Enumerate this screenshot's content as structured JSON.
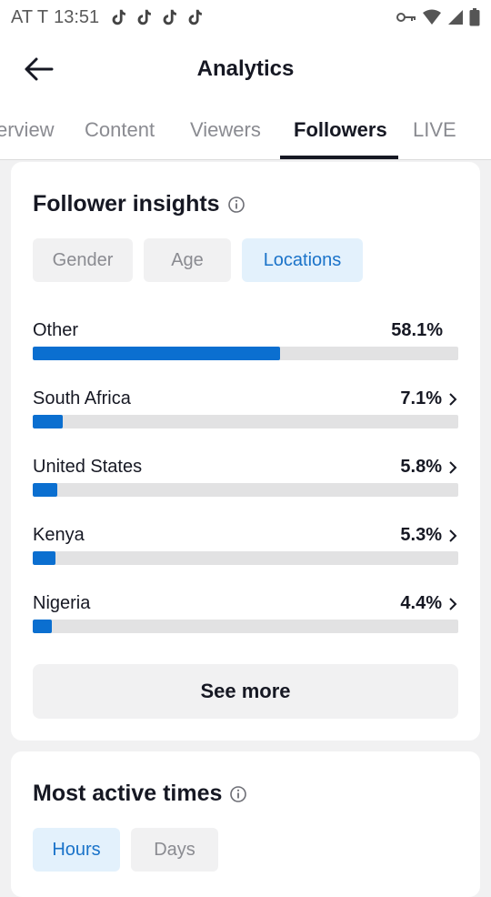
{
  "status_bar": {
    "carrier": "AT T",
    "time": "13:51",
    "notification_icons": [
      "tiktok-icon",
      "tiktok-icon",
      "tiktok-icon",
      "tiktok-icon"
    ],
    "right_icons": [
      "vpn-key-icon",
      "wifi-icon",
      "cell-signal-icon",
      "battery-icon"
    ]
  },
  "header": {
    "title": "Analytics"
  },
  "tabs": [
    {
      "label": "erview",
      "active": false
    },
    {
      "label": "Content",
      "active": false
    },
    {
      "label": "Viewers",
      "active": false
    },
    {
      "label": "Followers",
      "active": true
    },
    {
      "label": "LIVE",
      "active": false
    }
  ],
  "follower_insights": {
    "title": "Follower insights",
    "filters": [
      {
        "label": "Gender",
        "selected": false
      },
      {
        "label": "Age",
        "selected": false
      },
      {
        "label": "Locations",
        "selected": true
      }
    ],
    "locations": [
      {
        "name": "Other",
        "percent_label": "58.1%",
        "percent": 58.1,
        "has_arrow": false
      },
      {
        "name": "South Africa",
        "percent_label": "7.1%",
        "percent": 7.1,
        "has_arrow": true
      },
      {
        "name": "United States",
        "percent_label": "5.8%",
        "percent": 5.8,
        "has_arrow": true
      },
      {
        "name": "Kenya",
        "percent_label": "5.3%",
        "percent": 5.3,
        "has_arrow": true
      },
      {
        "name": "Nigeria",
        "percent_label": "4.4%",
        "percent": 4.4,
        "has_arrow": true
      }
    ],
    "see_more_label": "See more"
  },
  "most_active_times": {
    "title": "Most active times",
    "filters": [
      {
        "label": "Hours",
        "selected": true
      },
      {
        "label": "Days",
        "selected": false
      }
    ]
  },
  "colors": {
    "accent": "#0b6fd0",
    "selected_chip_bg": "#e3f1fc",
    "selected_chip_text": "#1a73c9"
  }
}
